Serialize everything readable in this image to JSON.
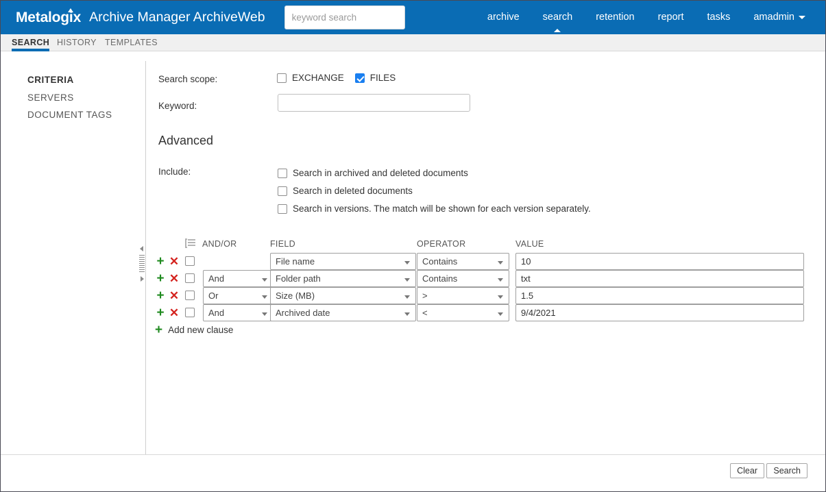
{
  "header": {
    "brand": "Metalogix",
    "app_title": "Archive Manager ArchiveWeb",
    "search_placeholder": "keyword search",
    "search_value": "",
    "nav": [
      {
        "label": "archive",
        "active": false
      },
      {
        "label": "search",
        "active": true
      },
      {
        "label": "retention",
        "active": false
      },
      {
        "label": "report",
        "active": false
      },
      {
        "label": "tasks",
        "active": false
      }
    ],
    "user": "amadmin"
  },
  "tabs": [
    {
      "label": "SEARCH",
      "active": true
    },
    {
      "label": "HISTORY",
      "active": false
    },
    {
      "label": "TEMPLATES",
      "active": false
    }
  ],
  "sidebar": {
    "items": [
      {
        "label": "CRITERIA",
        "active": true
      },
      {
        "label": "SERVERS",
        "active": false
      },
      {
        "label": "DOCUMENT TAGS",
        "active": false
      }
    ]
  },
  "form": {
    "scope_label": "Search scope:",
    "scope_options": [
      {
        "label": "EXCHANGE",
        "checked": false
      },
      {
        "label": "FILES",
        "checked": true
      }
    ],
    "keyword_label": "Keyword:",
    "keyword_value": "",
    "advanced_title": "Advanced",
    "include_label": "Include:",
    "include_options": [
      {
        "label": "Search in archived and deleted documents",
        "checked": false
      },
      {
        "label": "Search in deleted documents",
        "checked": false
      },
      {
        "label": "Search in versions. The match will be shown for each version separately.",
        "checked": false
      }
    ]
  },
  "criteria": {
    "columns": {
      "andor": "AND/OR",
      "field": "FIELD",
      "operator": "OPERATOR",
      "value": "VALUE"
    },
    "list_icon": "list-icon",
    "rows": [
      {
        "selected": false,
        "andor": "",
        "field": "File name",
        "operator": "Contains",
        "value": "10"
      },
      {
        "selected": false,
        "andor": "And",
        "field": "Folder path",
        "operator": "Contains",
        "value": "txt"
      },
      {
        "selected": false,
        "andor": "Or",
        "field": "Size (MB)",
        "operator": ">",
        "value": "1.5"
      },
      {
        "selected": false,
        "andor": "And",
        "field": "Archived date",
        "operator": "<",
        "value": "9/4/2021"
      }
    ],
    "add_clause_label": "Add new clause",
    "add_clause_icon": "+"
  },
  "footer": {
    "clear_label": "Clear",
    "search_label": "Search"
  },
  "colors": {
    "header_blue": "#0a6cb4",
    "accent_blue": "#1a7ff0",
    "add_green": "#1f8a1f",
    "delete_red": "#d4231f"
  }
}
